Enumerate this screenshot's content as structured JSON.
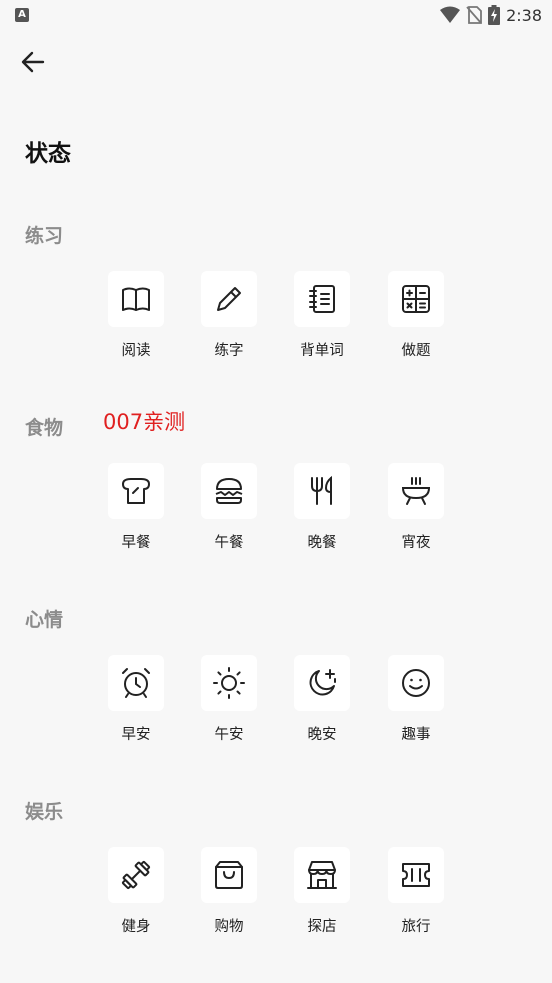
{
  "status_bar": {
    "time": "2:38",
    "left_badge": "A"
  },
  "header": {
    "title": "状态"
  },
  "annotation": "007亲测",
  "sections": [
    {
      "label": "练习",
      "items": [
        {
          "label": "阅读",
          "icon": "book-icon"
        },
        {
          "label": "练字",
          "icon": "pencil-icon"
        },
        {
          "label": "背单词",
          "icon": "notebook-icon"
        },
        {
          "label": "做题",
          "icon": "calculator-icon"
        }
      ]
    },
    {
      "label": "食物",
      "items": [
        {
          "label": "早餐",
          "icon": "toast-icon"
        },
        {
          "label": "午餐",
          "icon": "burger-icon"
        },
        {
          "label": "晚餐",
          "icon": "utensils-icon"
        },
        {
          "label": "宵夜",
          "icon": "grill-icon"
        }
      ]
    },
    {
      "label": "心情",
      "items": [
        {
          "label": "早安",
          "icon": "alarm-clock-icon"
        },
        {
          "label": "午安",
          "icon": "sun-icon"
        },
        {
          "label": "晚安",
          "icon": "moon-stars-icon"
        },
        {
          "label": "趣事",
          "icon": "smile-icon"
        }
      ]
    },
    {
      "label": "娱乐",
      "items": [
        {
          "label": "健身",
          "icon": "dumbbell-icon"
        },
        {
          "label": "购物",
          "icon": "shopping-bag-icon"
        },
        {
          "label": "探店",
          "icon": "store-icon"
        },
        {
          "label": "旅行",
          "icon": "ticket-icon"
        }
      ]
    }
  ]
}
